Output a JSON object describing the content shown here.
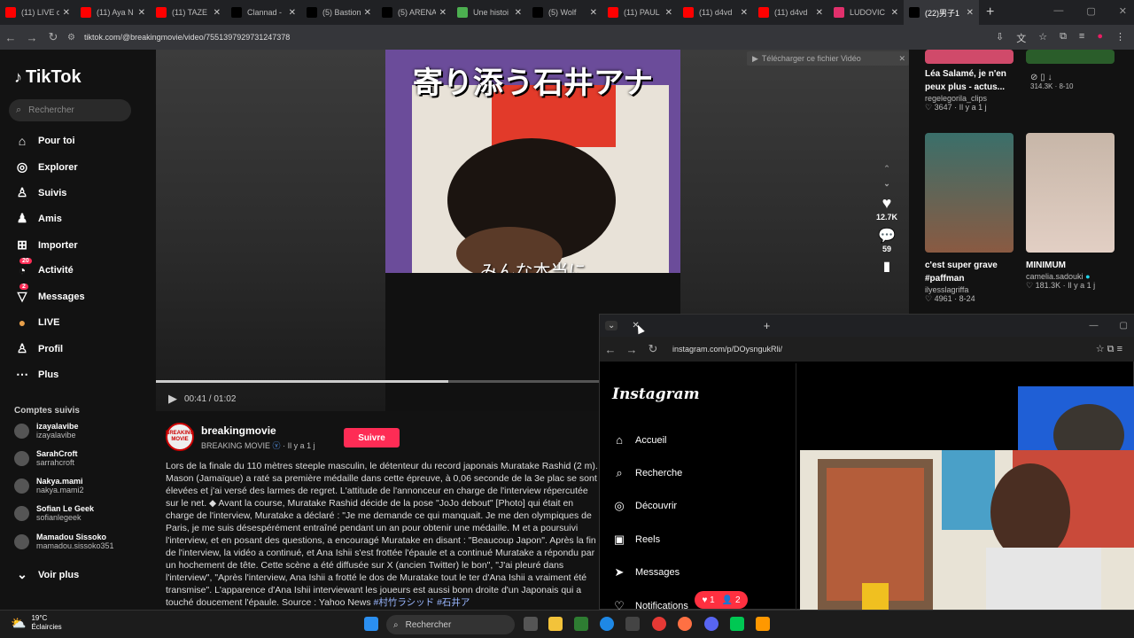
{
  "browser": {
    "tabs": [
      {
        "label": "(11) LIVE d",
        "icon": "youtube-icon",
        "color": "#ff0000"
      },
      {
        "label": "(11) Aya N",
        "icon": "youtube-icon",
        "color": "#ff0000"
      },
      {
        "label": "(11) TAZE",
        "icon": "youtube-icon",
        "color": "#ff0000"
      },
      {
        "label": "Clannad -",
        "icon": "x-icon",
        "color": "#000000"
      },
      {
        "label": "(5) Bastion",
        "icon": "x-icon",
        "color": "#000000"
      },
      {
        "label": "(5) ARENA",
        "icon": "x-icon",
        "color": "#000000"
      },
      {
        "label": "Une histoi",
        "icon": "site-icon",
        "color": "#4caf50"
      },
      {
        "label": "(5) Wolf",
        "icon": "x-icon",
        "color": "#000000"
      },
      {
        "label": "(11) PAUL",
        "icon": "youtube-icon",
        "color": "#ff0000"
      },
      {
        "label": "(11) d4vd",
        "icon": "youtube-icon",
        "color": "#ff0000"
      },
      {
        "label": "(11) d4vd",
        "icon": "youtube-icon",
        "color": "#ff0000"
      },
      {
        "label": "LUDOVIC",
        "icon": "instagram-icon",
        "color": "#e1306c"
      },
      {
        "label": "(22)男子1",
        "icon": "tiktok-icon",
        "color": "#000000",
        "active": true
      }
    ],
    "url": "tiktok.com/@breakingmovie/video/7551397929731247378"
  },
  "sidebar": {
    "logo": "TikTok",
    "search_placeholder": "Rechercher",
    "nav": [
      {
        "label": "Pour toi",
        "icon": "home-icon"
      },
      {
        "label": "Explorer",
        "icon": "compass-icon"
      },
      {
        "label": "Suivis",
        "icon": "following-icon"
      },
      {
        "label": "Amis",
        "icon": "friends-icon"
      },
      {
        "label": "Importer",
        "icon": "upload-icon"
      },
      {
        "label": "Activité",
        "icon": "activity-icon",
        "badge": "20"
      },
      {
        "label": "Messages",
        "icon": "messages-icon",
        "badge": "2"
      },
      {
        "label": "LIVE",
        "icon": "live-icon"
      },
      {
        "label": "Profil",
        "icon": "profile-icon"
      },
      {
        "label": "Plus",
        "icon": "more-icon"
      }
    ],
    "followed_title": "Comptes suivis",
    "followed": [
      {
        "name": "izayalavibe",
        "user": "izayalavibe"
      },
      {
        "name": "SarahCroft",
        "user": "sarrahcroft"
      },
      {
        "name": "Nakya.mami",
        "user": "nakya.mami2"
      },
      {
        "name": "Sofian Le Geek",
        "user": "sofianlegeek"
      },
      {
        "name": "Mamadou Sissoko",
        "user": "mamadou.sissoko351"
      }
    ],
    "see_more": "Voir plus"
  },
  "video": {
    "caption_top": "寄り添う石井アナ",
    "caption_bottom": "みんな本当に",
    "download_bar": "Télécharger ce fichier Vidéo",
    "time": "00:41 / 01:02",
    "progress": 0.66,
    "likes": "12.7K",
    "comments": "59"
  },
  "author": {
    "name": "breakingmovie",
    "display": "BREAKING MOVIE",
    "ago": "· Il y a 1 j",
    "avatar_text": "BREAKING MOVIE",
    "follow_label": "Suivre",
    "description": "Lors de la finale du 110 mètres steeple masculin, le détenteur du record japonais Muratake Rashid (2 m). Mason (Jamaïque) a raté sa première médaille dans cette épreuve, à 0,06 seconde de la 3e plac se sont élevées et j'ai versé des larmes de regret. L'attitude de l'annonceur en charge de l'interview répercutée sur le net. ◆ Avant la course, Muratake Rashid décide de la pose \"JoJo debout\" [Photo] qui était en charge de l'interview, Muratake a déclaré : \"Je me demande ce qui manquait. Je me den olympiques de Paris, je me suis désespérément entraîné pendant un an pour obtenir une médaille. M et a poursuivi l'interview, et en posant des questions, a encouragé Muratake en disant : \"Beaucoup Japon\". Après la fin de l'interview, la vidéo a continué, et Ana Ishii s'est frottée l'épaule et a continué Muratake a répondu par un hochement de tête. Cette scène a été diffusée sur X (ancien Twitter) le bon\", \"J'ai pleuré dans l'interview\", \"Après l'interview, Ana Ishii a frotté le dos de Muratake tout le ter d'Ana Ishii a vraiment été transmise\". L'apparence d'Ana Ishii interviewant les joueurs est aussi bonn droite d'un Japonais qui a touché doucement l'épaule. Source : Yahoo News",
    "hashtags": "#村竹ラシッド #石井ア"
  },
  "related": [
    {
      "title": "Léa Salamé, je n'en peux plus - actus...",
      "user": "regelegorila_clips",
      "likes": "3647",
      "ago": "Il y a 1 j"
    },
    {
      "title": "c'est super grave #paffman",
      "user": "ilyesslagriffa",
      "likes": "4961",
      "ago": "8-24"
    },
    {
      "title": "MINIMUM",
      "user": "camelia.sadouki",
      "likes": "181.3K",
      "ago": "Il y a 1 j"
    }
  ],
  "related_top_right_stats": "314.3K · 8-10",
  "instagram": {
    "url": "instagram.com/p/DOysngukRli/",
    "logo": "Instagram",
    "nav": [
      {
        "label": "Accueil",
        "icon": "home-icon"
      },
      {
        "label": "Recherche",
        "icon": "search-icon"
      },
      {
        "label": "Découvrir",
        "icon": "compass-icon"
      },
      {
        "label": "Reels",
        "icon": "reels-icon"
      },
      {
        "label": "Messages",
        "icon": "send-icon"
      },
      {
        "label": "Notifications",
        "icon": "heart-icon"
      }
    ],
    "notif_likes": "1",
    "notif_follows": "2"
  },
  "taskbar": {
    "temp": "19°C",
    "weather": "Éclaircies",
    "search": "Rechercher"
  },
  "colors": {
    "accent": "#fe2c55",
    "bg": "#121212"
  }
}
